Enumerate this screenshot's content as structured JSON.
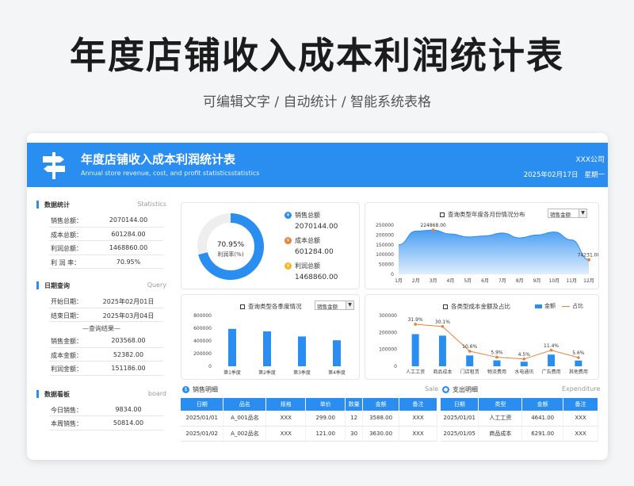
{
  "page": {
    "title": "年度店铺收入成本利润统计表",
    "subtitle": "可编辑文字 / 自动统计 / 智能系统表格"
  },
  "banner": {
    "title": "年度店铺收入成本利润统计表",
    "subtitle": "Annual store revenue, cost, and profit statisticsstatistics",
    "company": "XXX公司",
    "date": "2025年02月17日",
    "weekday": "星期一"
  },
  "colors": {
    "accent": "#2a8df0",
    "orange": "#e8823a",
    "yellow": "#f5b621"
  },
  "sidebar": {
    "stats": {
      "title": "数据统计",
      "en": "Statistics",
      "rows": [
        {
          "k": "销售总额：",
          "v": "2070144.00"
        },
        {
          "k": "成本总额：",
          "v": "601284.00"
        },
        {
          "k": "利润总额：",
          "v": "1468860.00"
        },
        {
          "k": "利  润  率：",
          "v": "70.95%"
        }
      ]
    },
    "query": {
      "title": "日期查询",
      "en": "Query",
      "start_label": "开始日期：",
      "start": "2025年02月01日",
      "end_label": "结束日期：",
      "end": "2025年03月04日",
      "result_label": "—查询结果—",
      "rows": [
        {
          "k": "销售金额：",
          "v": "203568.00"
        },
        {
          "k": "成本金额：",
          "v": "52382.00"
        },
        {
          "k": "利润金额：",
          "v": "151186.00"
        }
      ]
    },
    "board": {
      "title": "数据看板",
      "en": "board",
      "rows": [
        {
          "k": "今日销售：",
          "v": "9834.00"
        },
        {
          "k": "本周销售：",
          "v": "50814.00"
        }
      ]
    }
  },
  "donut": {
    "center_value": "70.95%",
    "center_label": "利润率(%)",
    "items": [
      {
        "label": "销售总额",
        "value": "2070144.00",
        "icon": "¥"
      },
      {
        "label": "成本总额",
        "value": "601284.00",
        "icon": "¥"
      },
      {
        "label": "利润总额",
        "value": "1468860.00",
        "icon": "¥"
      }
    ]
  },
  "monthly": {
    "title": "查询类型年度各月份情况分布",
    "select": "销售金额"
  },
  "quarterly": {
    "title": "查询类型各季度情况",
    "select": "销售金额"
  },
  "costs": {
    "title": "各类型成本金额及占比",
    "legend_bar": "金额",
    "legend_line": "占比"
  },
  "sales_table": {
    "title": "销售明细",
    "en": "Sale",
    "headers": [
      "日期",
      "品名",
      "规格",
      "单价",
      "数量",
      "金额",
      "备注"
    ],
    "rows": [
      [
        "2025/01/01",
        "A_001品名",
        "XXX",
        "299.00",
        "12",
        "3588.00",
        "XXX"
      ],
      [
        "2025/01/02",
        "A_002品名",
        "XXX",
        "121.00",
        "30",
        "3630.00",
        "XXX"
      ]
    ]
  },
  "expense_table": {
    "title": "支出明细",
    "en": "Expenditure",
    "headers": [
      "日期",
      "类型",
      "金额",
      "备注"
    ],
    "rows": [
      [
        "2025/01/01",
        "人工工资",
        "4641.00",
        "XXX"
      ],
      [
        "2025/01/05",
        "商品成本",
        "6291.00",
        "XXX"
      ]
    ]
  },
  "chart_data": [
    {
      "type": "pie",
      "title": "",
      "categories": [
        "利润率"
      ],
      "values": [
        70.95
      ],
      "ylim": [
        0,
        100
      ]
    },
    {
      "type": "area",
      "title": "查询类型年度各月份情况分布",
      "categories": [
        "1月",
        "2月",
        "3月",
        "4月",
        "5月",
        "6月",
        "7月",
        "8月",
        "9月",
        "10月",
        "11月",
        "12月"
      ],
      "values": [
        150000,
        220000,
        224868,
        205000,
        190000,
        195000,
        210000,
        185000,
        200000,
        215000,
        175000,
        74231
      ],
      "labels": {
        "2": "224868.00",
        "11": "74231.00"
      },
      "yticks": [
        "0",
        "50000",
        "100000",
        "150000",
        "200000",
        "250000"
      ],
      "ylim": [
        0,
        250000
      ]
    },
    {
      "type": "bar",
      "title": "查询类型各季度情况",
      "categories": [
        "第1季度",
        "第2季度",
        "第3季度",
        "第4季度"
      ],
      "values": [
        590000,
        550000,
        470000,
        410000
      ],
      "yticks": [
        "0",
        "200000",
        "400000",
        "600000",
        "800000"
      ],
      "ylim": [
        0,
        800000
      ]
    },
    {
      "type": "bar",
      "title": "各类型成本金额及占比",
      "categories": [
        "人工工资",
        "商品成本",
        "门店租赁",
        "物流费用",
        "水电通讯",
        "广告费用",
        "其他费用"
      ],
      "series": [
        {
          "name": "金额",
          "values": [
            190000,
            181000,
            64000,
            35000,
            27000,
            69000,
            34000
          ]
        },
        {
          "name": "占比",
          "values": [
            31.9,
            30.1,
            10.6,
            5.9,
            4.5,
            11.4,
            5.6
          ]
        }
      ],
      "pct_labels": [
        "31.9%",
        "30.1%",
        "10.6%",
        "5.9%",
        "4.5%",
        "11.4%",
        "5.6%"
      ],
      "yticks": [
        "0",
        "100000",
        "200000",
        "300000"
      ],
      "ylim": [
        0,
        300000
      ]
    }
  ]
}
